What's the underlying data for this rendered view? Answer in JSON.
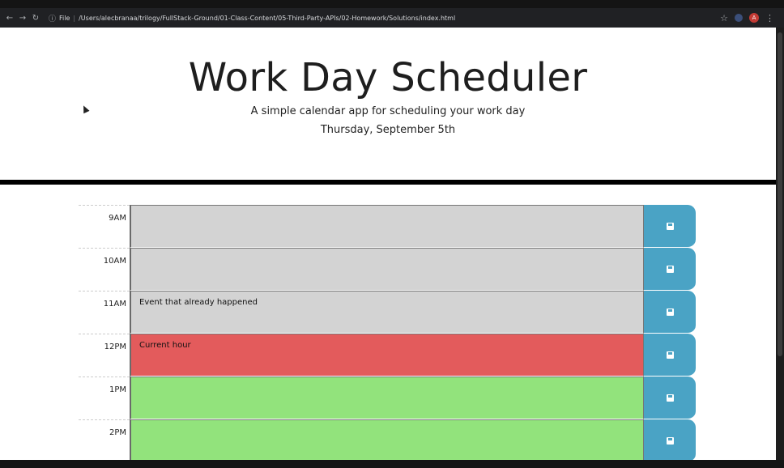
{
  "browser": {
    "url_scheme": "File",
    "url_path": "/Users/alecbranaa/trilogy/FullStack-Ground/01-Class-Content/05-Third-Party-APIs/02-Homework/Solutions/index.html",
    "nav_back_icon": "←",
    "nav_forward_icon": "→",
    "reload_icon": "↻",
    "info_icon": "ⓘ",
    "star_icon": "☆",
    "menu_icon": "⋮",
    "avatar_letter": "A"
  },
  "header": {
    "title": "Work Day Scheduler",
    "lead": "A simple calendar app for scheduling your work day",
    "current_day": "Thursday, September 5th"
  },
  "colors": {
    "past": "#d3d3d3",
    "present": "#e35b5c",
    "future": "#92e37c",
    "save_button": "#4aa3c5"
  },
  "timeblocks": [
    {
      "hour": "9AM",
      "text": "",
      "state": "past"
    },
    {
      "hour": "10AM",
      "text": "",
      "state": "past"
    },
    {
      "hour": "11AM",
      "text": "Event that already happened",
      "state": "past"
    },
    {
      "hour": "12PM",
      "text": "Current hour",
      "state": "present"
    },
    {
      "hour": "1PM",
      "text": "",
      "state": "future"
    },
    {
      "hour": "2PM",
      "text": "",
      "state": "future"
    }
  ]
}
